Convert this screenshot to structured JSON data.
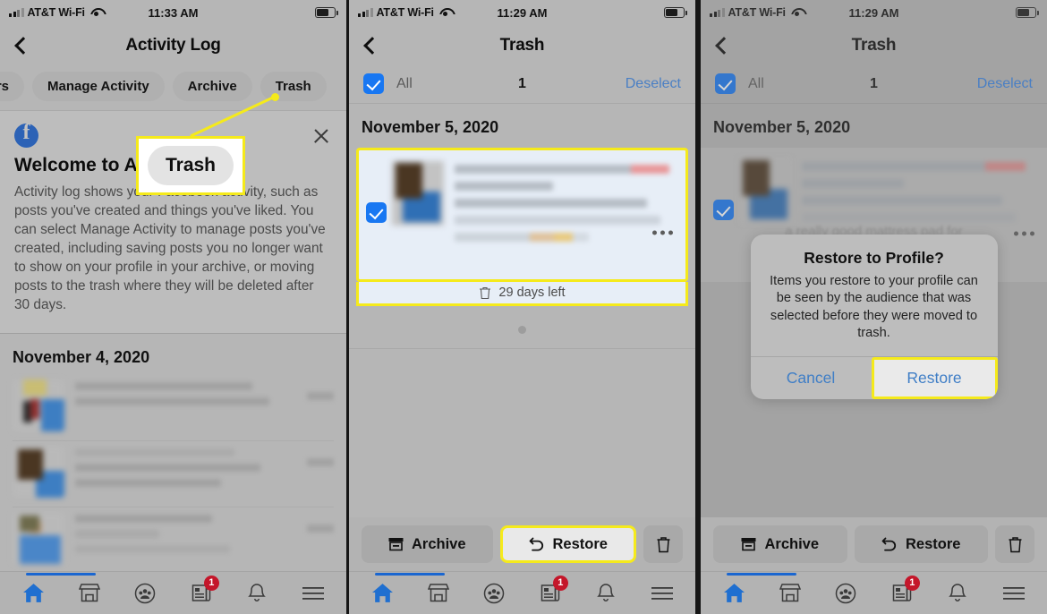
{
  "panels": [
    {
      "id": "activity-log",
      "status": {
        "carrier": "AT&T Wi-Fi",
        "time": "11:33 AM"
      },
      "nav": {
        "title": "Activity Log",
        "back_icon": "back-chevron-icon"
      },
      "chips": [
        "Filters",
        "Manage Activity",
        "Archive",
        "Trash"
      ],
      "callout": {
        "label": "Trash",
        "highlight_color": "#f5ea1b"
      },
      "welcome": {
        "logo": "facebook-logo-icon",
        "title": "Welcome to Ac",
        "body": "Activity log shows your Facebook activity, such as posts you've created and things you've liked. You can select Manage Activity to manage posts you've created, including saving posts you no longer want to show on your profile in your archive, or moving posts to the trash where they will be deleted after 30 days.",
        "close_icon": "close-icon"
      },
      "date_header": "November 4, 2020",
      "rows": [
        {
          "avatar": "avatar-blurred",
          "lines": 2,
          "timestamp": "blurred"
        },
        {
          "avatar": "avatar-blurred",
          "lines": 3,
          "timestamp": "blurred"
        },
        {
          "avatar": "avatar-blurred",
          "lines": 3,
          "timestamp": "blurred"
        }
      ]
    },
    {
      "id": "trash-selected",
      "status": {
        "carrier": "AT&T Wi-Fi",
        "time": "11:29 AM"
      },
      "nav": {
        "title": "Trash",
        "back_icon": "back-chevron-icon"
      },
      "selection": {
        "all_label": "All",
        "count": "1",
        "deselect_label": "Deselect",
        "checked": true
      },
      "date_header": "November 5, 2020",
      "card": {
        "checked": true,
        "days_left": "29 days left",
        "trash_icon": "trash-icon",
        "more_icon": "more-options-icon",
        "highlighted": true
      },
      "actions": {
        "archive_label": "Archive",
        "restore_label": "Restore",
        "delete_icon": "trash-icon",
        "archive_icon": "archive-box-icon",
        "restore_icon": "undo-arrow-icon",
        "highlighted": "restore"
      }
    },
    {
      "id": "trash-restore-dialog",
      "status": {
        "carrier": "AT&T Wi-Fi",
        "time": "11:29 AM"
      },
      "nav": {
        "title": "Trash",
        "back_icon": "back-chevron-icon"
      },
      "selection": {
        "all_label": "All",
        "count": "1",
        "deselect_label": "Deselect",
        "checked": true
      },
      "date_header": "November 5, 2020",
      "ghost_text": "a really good mattress pad for",
      "dialog": {
        "title": "Restore to Profile?",
        "body": "Items you restore to your profile can be seen by the audience that was selected before they were moved to trash.",
        "cancel_label": "Cancel",
        "restore_label": "Restore",
        "highlighted": "restore"
      },
      "actions": {
        "archive_label": "Archive",
        "restore_label": "Restore",
        "delete_icon": "trash-icon",
        "archive_icon": "archive-box-icon",
        "restore_icon": "undo-arrow-icon",
        "highlighted": "none"
      }
    }
  ],
  "bottom_nav": {
    "items": [
      {
        "icon": "home-icon",
        "active": true,
        "badge": ""
      },
      {
        "icon": "marketplace-icon",
        "active": false,
        "badge": ""
      },
      {
        "icon": "groups-icon",
        "active": false,
        "badge": ""
      },
      {
        "icon": "news-icon",
        "active": false,
        "badge": "1"
      },
      {
        "icon": "bell-icon",
        "active": false,
        "badge": ""
      },
      {
        "icon": "menu-icon",
        "active": false,
        "badge": ""
      }
    ]
  },
  "colors": {
    "accent_blue": "#1877f2",
    "link_blue": "#4a7fc4",
    "highlight_yellow": "#f5ea1b",
    "badge_red": "#c4162a"
  }
}
